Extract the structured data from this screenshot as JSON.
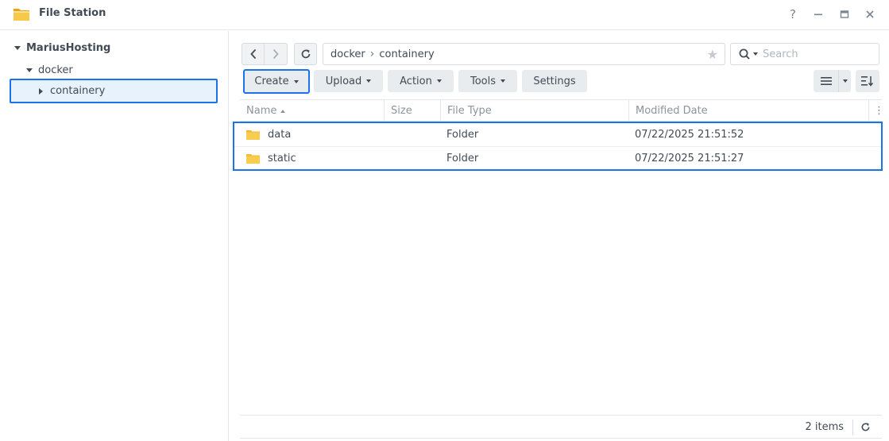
{
  "window": {
    "title": "File Station",
    "controls": {
      "help": "?",
      "minimize": "–",
      "maximize": "□",
      "close": "✕"
    }
  },
  "sidebar": {
    "root": "MariusHosting",
    "children": [
      {
        "label": "docker",
        "expanded": true
      },
      {
        "label": "containery",
        "selected": true
      }
    ]
  },
  "path": {
    "segments": [
      "docker",
      "containery"
    ],
    "separator": "›"
  },
  "search": {
    "placeholder": "Search"
  },
  "toolbar": {
    "create": "Create",
    "upload": "Upload",
    "action": "Action",
    "tools": "Tools",
    "settings": "Settings"
  },
  "table": {
    "columns": [
      "Name",
      "Size",
      "File Type",
      "Modified Date"
    ],
    "rows": [
      {
        "name": "data",
        "size": "",
        "type": "Folder",
        "modified": "07/22/2025 21:51:52"
      },
      {
        "name": "static",
        "size": "",
        "type": "Folder",
        "modified": "07/22/2025 21:51:27"
      }
    ]
  },
  "footer": {
    "count": "2 items"
  },
  "colors": {
    "accent": "#1a73e8",
    "folder": "#f6c343",
    "text": "#414b55"
  }
}
